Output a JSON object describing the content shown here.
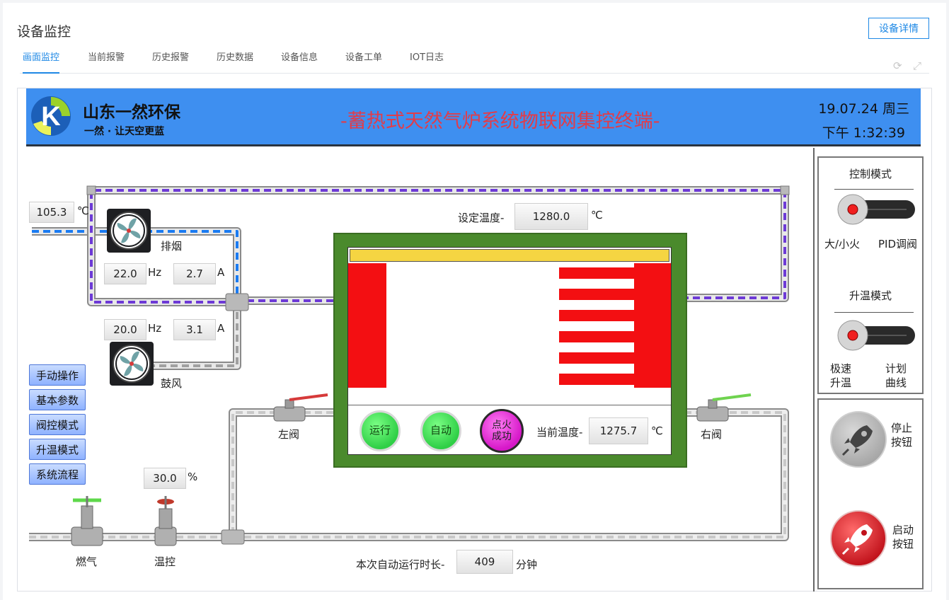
{
  "page": {
    "title": "设备监控",
    "detail_button": "设备详情",
    "tabs": [
      {
        "label": "画面监控",
        "active": true
      },
      {
        "label": "当前报警"
      },
      {
        "label": "历史报警"
      },
      {
        "label": "历史数据"
      },
      {
        "label": "设备信息"
      },
      {
        "label": "设备工单"
      },
      {
        "label": "IOT日志"
      }
    ],
    "tool_icons": [
      "refresh-icon",
      "fullscreen-icon"
    ]
  },
  "hmi": {
    "company_name": "山东一然环保",
    "slogan": "一然 · 让天空更蓝",
    "system_title": "-蓄热式天然气炉系统物联网集控终端-",
    "date": "19.07.24 周三",
    "time": "下午 1:32:39",
    "colors": {
      "banner": "#3e8ff0",
      "title_red": "#e23c49",
      "furnace_green": "#4a8a2c",
      "heater_red": "#f30f12",
      "pipe_purple": "#6d3ad6",
      "pipe_blue": "#1a7bf2"
    },
    "exhaust_temp": {
      "value": "105.3",
      "unit": "℃"
    },
    "exhaust_fan": {
      "label": "排烟",
      "freq": "22.0",
      "freq_unit": "Hz",
      "current": "2.7",
      "current_unit": "A"
    },
    "blower_fan": {
      "label": "鼓风",
      "freq": "20.0",
      "freq_unit": "Hz",
      "current": "3.1",
      "current_unit": "A"
    },
    "set_temp": {
      "label": "设定温度-",
      "value": "1280.0",
      "unit": "℃"
    },
    "current_temp": {
      "label": "当前温度-",
      "value": "1275.7",
      "unit": "℃"
    },
    "status_buttons": {
      "run": "运行",
      "auto": "自动",
      "ignite": "点火\n成功"
    },
    "left_valve": "左阀",
    "right_valve": "右阀",
    "gas_valve": "燃气",
    "temp_valve": {
      "label": "温控",
      "value": "30.0",
      "unit": "%"
    },
    "runtime": {
      "label": "本次自动运行时长-",
      "value": "409",
      "unit": "分钟"
    },
    "menu": [
      "手动操作",
      "基本参数",
      "阀控模式",
      "升温模式",
      "系统流程"
    ],
    "control_mode": {
      "title": "控制模式",
      "left": "大/小火",
      "right": "PID调阀"
    },
    "heat_mode": {
      "title": "升温模式",
      "left": "极速\n升温",
      "right": "计划\n曲线"
    },
    "stop_button": "停止\n按钮",
    "start_button": "启动\n按钮"
  }
}
